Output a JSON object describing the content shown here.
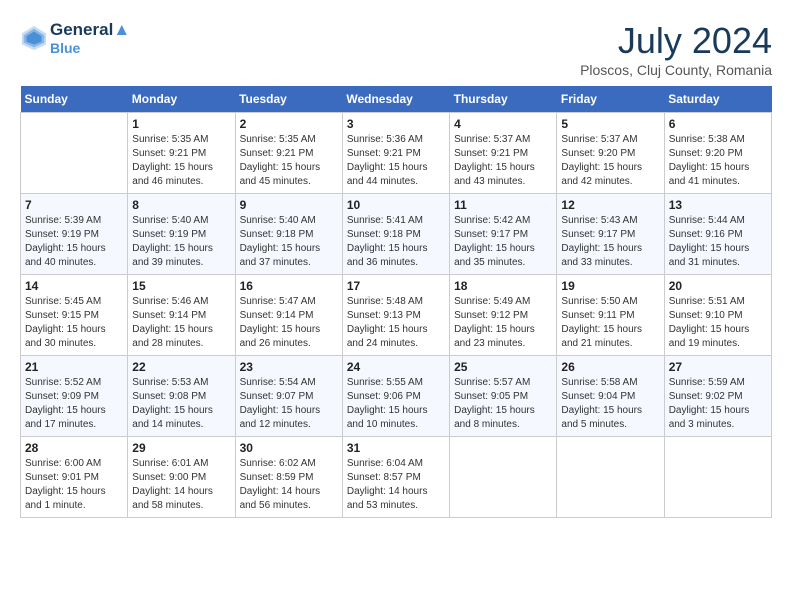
{
  "header": {
    "logo_line1": "General",
    "logo_line2": "Blue",
    "month_year": "July 2024",
    "location": "Ploscos, Cluj County, Romania"
  },
  "weekdays": [
    "Sunday",
    "Monday",
    "Tuesday",
    "Wednesday",
    "Thursday",
    "Friday",
    "Saturday"
  ],
  "weeks": [
    [
      {
        "day": "",
        "sunrise": "",
        "sunset": "",
        "daylight": ""
      },
      {
        "day": "1",
        "sunrise": "Sunrise: 5:35 AM",
        "sunset": "Sunset: 9:21 PM",
        "daylight": "Daylight: 15 hours and 46 minutes."
      },
      {
        "day": "2",
        "sunrise": "Sunrise: 5:35 AM",
        "sunset": "Sunset: 9:21 PM",
        "daylight": "Daylight: 15 hours and 45 minutes."
      },
      {
        "day": "3",
        "sunrise": "Sunrise: 5:36 AM",
        "sunset": "Sunset: 9:21 PM",
        "daylight": "Daylight: 15 hours and 44 minutes."
      },
      {
        "day": "4",
        "sunrise": "Sunrise: 5:37 AM",
        "sunset": "Sunset: 9:21 PM",
        "daylight": "Daylight: 15 hours and 43 minutes."
      },
      {
        "day": "5",
        "sunrise": "Sunrise: 5:37 AM",
        "sunset": "Sunset: 9:20 PM",
        "daylight": "Daylight: 15 hours and 42 minutes."
      },
      {
        "day": "6",
        "sunrise": "Sunrise: 5:38 AM",
        "sunset": "Sunset: 9:20 PM",
        "daylight": "Daylight: 15 hours and 41 minutes."
      }
    ],
    [
      {
        "day": "7",
        "sunrise": "Sunrise: 5:39 AM",
        "sunset": "Sunset: 9:19 PM",
        "daylight": "Daylight: 15 hours and 40 minutes."
      },
      {
        "day": "8",
        "sunrise": "Sunrise: 5:40 AM",
        "sunset": "Sunset: 9:19 PM",
        "daylight": "Daylight: 15 hours and 39 minutes."
      },
      {
        "day": "9",
        "sunrise": "Sunrise: 5:40 AM",
        "sunset": "Sunset: 9:18 PM",
        "daylight": "Daylight: 15 hours and 37 minutes."
      },
      {
        "day": "10",
        "sunrise": "Sunrise: 5:41 AM",
        "sunset": "Sunset: 9:18 PM",
        "daylight": "Daylight: 15 hours and 36 minutes."
      },
      {
        "day": "11",
        "sunrise": "Sunrise: 5:42 AM",
        "sunset": "Sunset: 9:17 PM",
        "daylight": "Daylight: 15 hours and 35 minutes."
      },
      {
        "day": "12",
        "sunrise": "Sunrise: 5:43 AM",
        "sunset": "Sunset: 9:17 PM",
        "daylight": "Daylight: 15 hours and 33 minutes."
      },
      {
        "day": "13",
        "sunrise": "Sunrise: 5:44 AM",
        "sunset": "Sunset: 9:16 PM",
        "daylight": "Daylight: 15 hours and 31 minutes."
      }
    ],
    [
      {
        "day": "14",
        "sunrise": "Sunrise: 5:45 AM",
        "sunset": "Sunset: 9:15 PM",
        "daylight": "Daylight: 15 hours and 30 minutes."
      },
      {
        "day": "15",
        "sunrise": "Sunrise: 5:46 AM",
        "sunset": "Sunset: 9:14 PM",
        "daylight": "Daylight: 15 hours and 28 minutes."
      },
      {
        "day": "16",
        "sunrise": "Sunrise: 5:47 AM",
        "sunset": "Sunset: 9:14 PM",
        "daylight": "Daylight: 15 hours and 26 minutes."
      },
      {
        "day": "17",
        "sunrise": "Sunrise: 5:48 AM",
        "sunset": "Sunset: 9:13 PM",
        "daylight": "Daylight: 15 hours and 24 minutes."
      },
      {
        "day": "18",
        "sunrise": "Sunrise: 5:49 AM",
        "sunset": "Sunset: 9:12 PM",
        "daylight": "Daylight: 15 hours and 23 minutes."
      },
      {
        "day": "19",
        "sunrise": "Sunrise: 5:50 AM",
        "sunset": "Sunset: 9:11 PM",
        "daylight": "Daylight: 15 hours and 21 minutes."
      },
      {
        "day": "20",
        "sunrise": "Sunrise: 5:51 AM",
        "sunset": "Sunset: 9:10 PM",
        "daylight": "Daylight: 15 hours and 19 minutes."
      }
    ],
    [
      {
        "day": "21",
        "sunrise": "Sunrise: 5:52 AM",
        "sunset": "Sunset: 9:09 PM",
        "daylight": "Daylight: 15 hours and 17 minutes."
      },
      {
        "day": "22",
        "sunrise": "Sunrise: 5:53 AM",
        "sunset": "Sunset: 9:08 PM",
        "daylight": "Daylight: 15 hours and 14 minutes."
      },
      {
        "day": "23",
        "sunrise": "Sunrise: 5:54 AM",
        "sunset": "Sunset: 9:07 PM",
        "daylight": "Daylight: 15 hours and 12 minutes."
      },
      {
        "day": "24",
        "sunrise": "Sunrise: 5:55 AM",
        "sunset": "Sunset: 9:06 PM",
        "daylight": "Daylight: 15 hours and 10 minutes."
      },
      {
        "day": "25",
        "sunrise": "Sunrise: 5:57 AM",
        "sunset": "Sunset: 9:05 PM",
        "daylight": "Daylight: 15 hours and 8 minutes."
      },
      {
        "day": "26",
        "sunrise": "Sunrise: 5:58 AM",
        "sunset": "Sunset: 9:04 PM",
        "daylight": "Daylight: 15 hours and 5 minutes."
      },
      {
        "day": "27",
        "sunrise": "Sunrise: 5:59 AM",
        "sunset": "Sunset: 9:02 PM",
        "daylight": "Daylight: 15 hours and 3 minutes."
      }
    ],
    [
      {
        "day": "28",
        "sunrise": "Sunrise: 6:00 AM",
        "sunset": "Sunset: 9:01 PM",
        "daylight": "Daylight: 15 hours and 1 minute."
      },
      {
        "day": "29",
        "sunrise": "Sunrise: 6:01 AM",
        "sunset": "Sunset: 9:00 PM",
        "daylight": "Daylight: 14 hours and 58 minutes."
      },
      {
        "day": "30",
        "sunrise": "Sunrise: 6:02 AM",
        "sunset": "Sunset: 8:59 PM",
        "daylight": "Daylight: 14 hours and 56 minutes."
      },
      {
        "day": "31",
        "sunrise": "Sunrise: 6:04 AM",
        "sunset": "Sunset: 8:57 PM",
        "daylight": "Daylight: 14 hours and 53 minutes."
      },
      {
        "day": "",
        "sunrise": "",
        "sunset": "",
        "daylight": ""
      },
      {
        "day": "",
        "sunrise": "",
        "sunset": "",
        "daylight": ""
      },
      {
        "day": "",
        "sunrise": "",
        "sunset": "",
        "daylight": ""
      }
    ]
  ]
}
